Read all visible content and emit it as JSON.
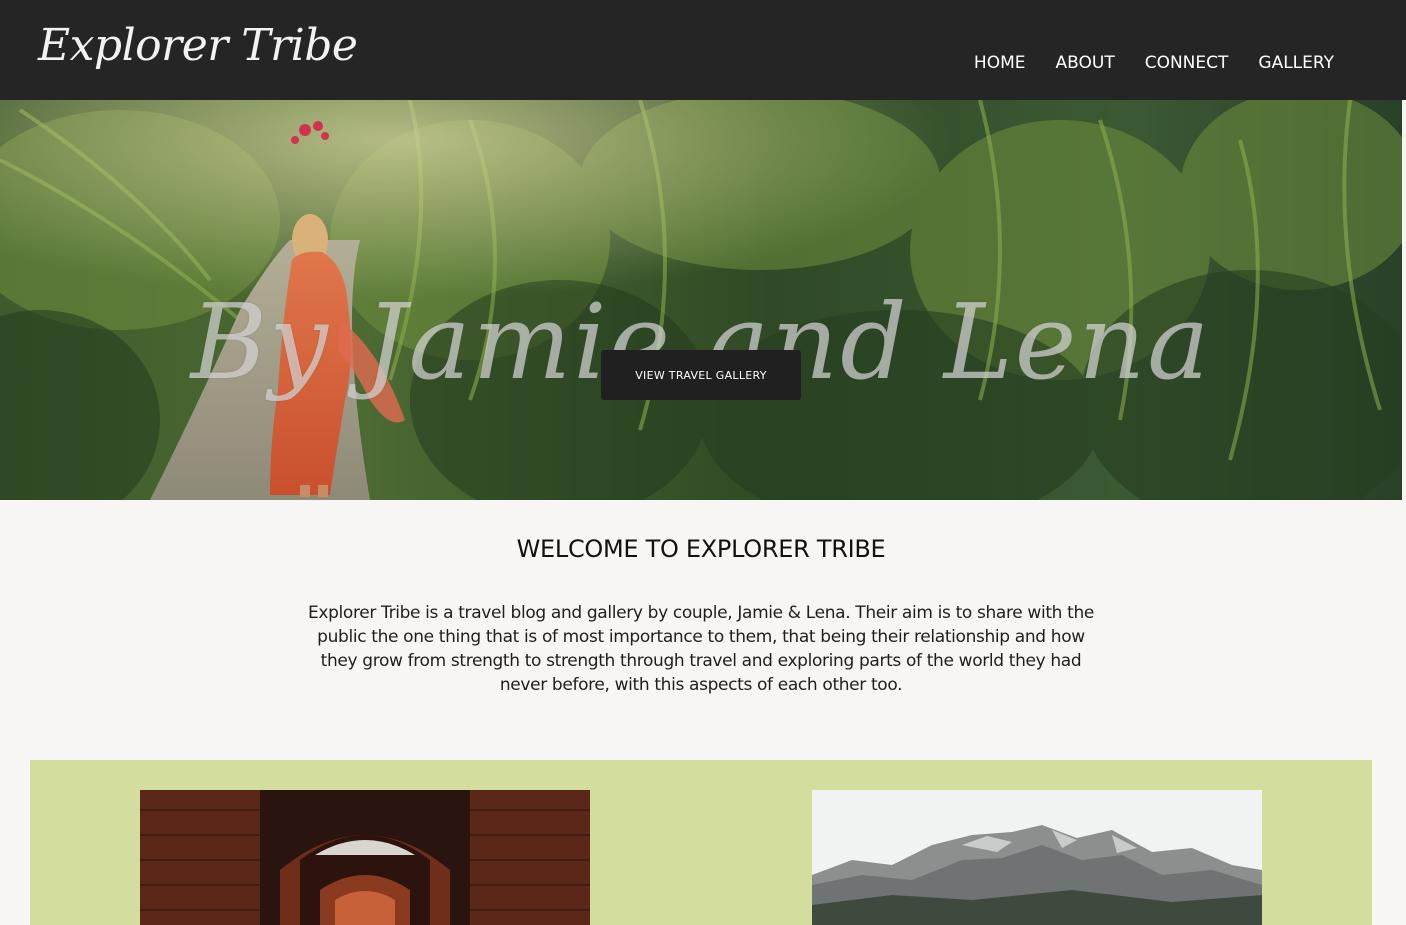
{
  "header": {
    "logo_text": "Explorer Tribe",
    "background_color": "#252525",
    "nav": [
      {
        "label": "HOME"
      },
      {
        "label": "ABOUT"
      },
      {
        "label": "CONNECT"
      },
      {
        "label": "GALLERY"
      }
    ]
  },
  "hero": {
    "title": "By Jamie and Lena",
    "button_label": "VIEW TRAVEL GALLERY",
    "button_color": "#202020",
    "image_subject": "woman-in-red-dress-on-jungle-path"
  },
  "intro": {
    "heading": "WELCOME TO EXPLORER TRIBE",
    "body": "Explorer Tribe is a travel blog and gallery by couple, Jamie & Lena. Their aim is to share with the public the one thing that is of most importance to them, that being their relationship and how they grow from strength to strength through travel and exploring parts of the world they had never before, with this aspects of each other too."
  },
  "gallery": {
    "panel_color": "#d2dd9e",
    "images": [
      {
        "subject": "brick-archway-corridor"
      },
      {
        "subject": "rocky-mountain-peak"
      }
    ]
  }
}
